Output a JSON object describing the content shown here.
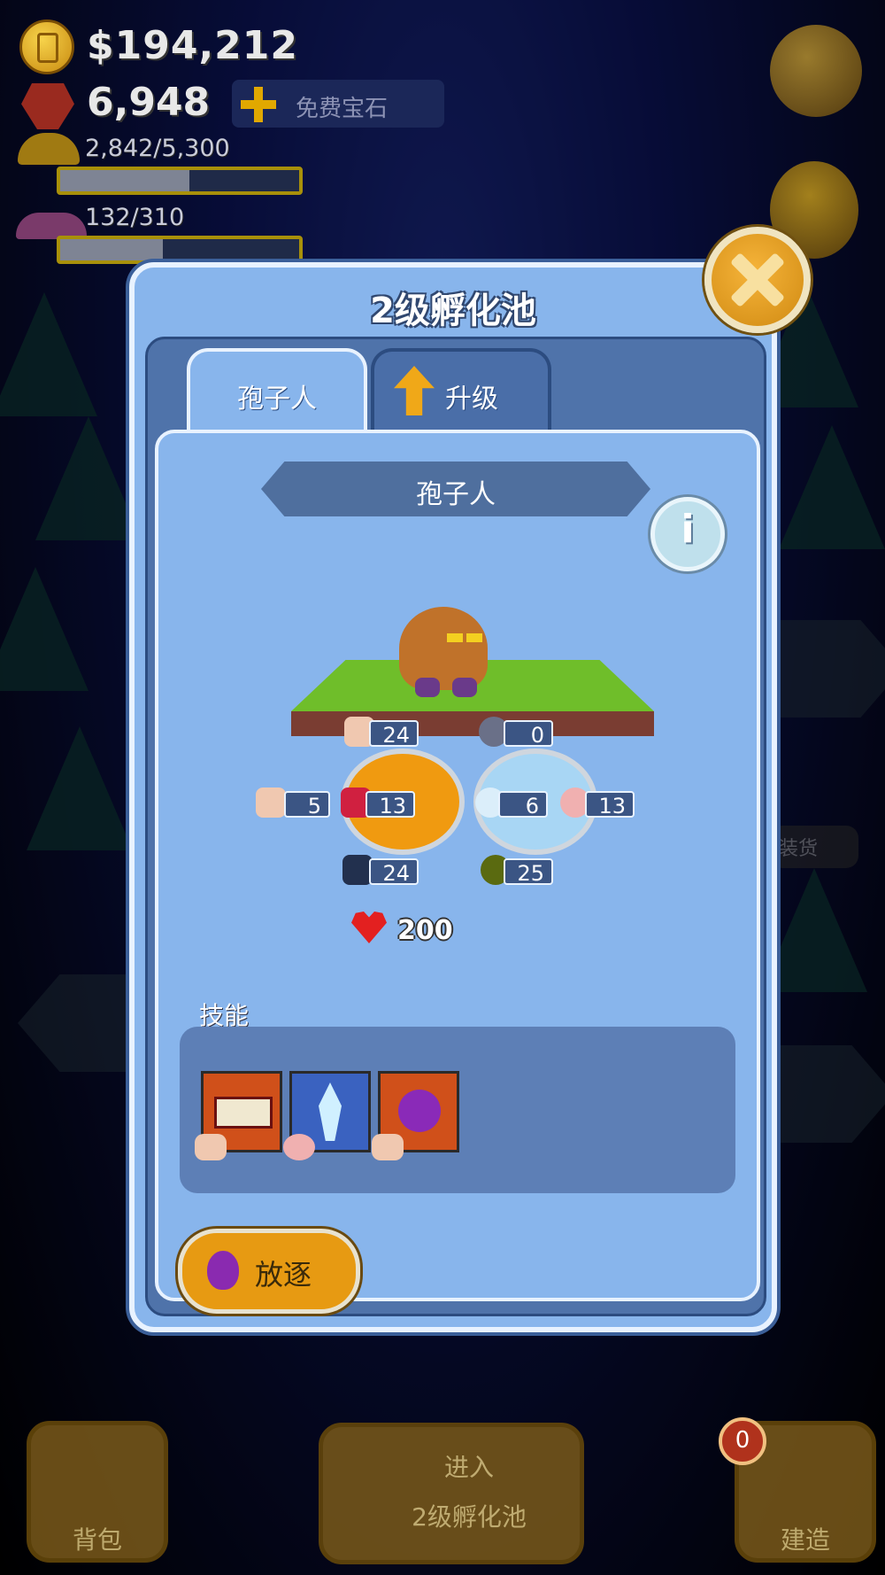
{
  "hud": {
    "money": "$194,212",
    "gems": "6,948",
    "free_gems_label": "免费宝石",
    "resource1": {
      "text": "2,842/5,300",
      "current": 2842,
      "max": 5300
    },
    "resource2": {
      "text": "132/310",
      "current": 132,
      "max": 310
    },
    "icons": [
      "coin-icon",
      "gem-icon",
      "plus-icon",
      "mushroom-yellow-icon",
      "mushroom-purple-icon",
      "wrench-icon",
      "trophy-icon"
    ]
  },
  "modal": {
    "title": "2级孵化池",
    "tabs": [
      {
        "label": "孢子人",
        "selected": true
      },
      {
        "label": "升级",
        "selected": false
      }
    ],
    "creature_name": "孢子人",
    "stats": {
      "strength": "24",
      "defense": "0",
      "hands": "5",
      "attack": "13",
      "magic": "6",
      "intellect": "13",
      "speed": "24",
      "perception": "25"
    },
    "hp": "200",
    "skills_label": "技能",
    "skills": [
      {
        "icon": "teeth-icon"
      },
      {
        "icon": "ice-crystal-icon"
      },
      {
        "icon": "purple-orb-icon"
      }
    ],
    "exile_label": "放逐"
  },
  "bottom": {
    "backpack_label": "背包",
    "enter_line1": "进入",
    "enter_line2": "2级孵化池",
    "build_label": "建造",
    "build_badge": "0"
  },
  "background": {
    "side_label": "装货"
  }
}
